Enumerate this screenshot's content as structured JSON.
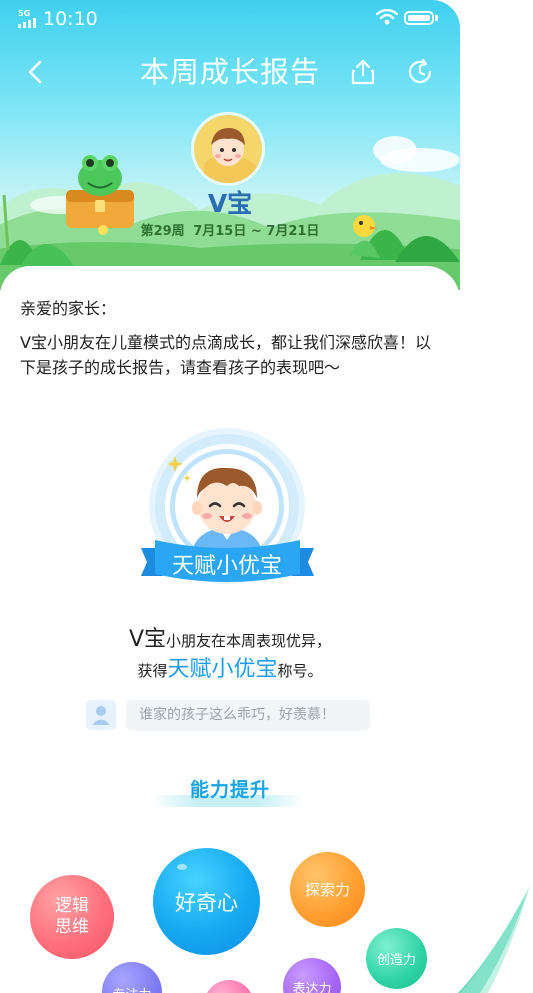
{
  "status_bar": {
    "network": "5G",
    "time": "10:10"
  },
  "nav": {
    "title": "本周成长报告"
  },
  "profile": {
    "name": "V宝",
    "week_label": "第29周",
    "date_range": "7月15日 ~ 7月21日"
  },
  "letter": {
    "greeting": "亲爱的家长：",
    "body": "V宝小朋友在儿童模式的点滴成长，都让我们深感欣喜！以下是孩子的成长报告，请查看孩子的表现吧～"
  },
  "award": {
    "badge_text": "天赋小优宝",
    "line1_name": "V宝",
    "line1_rest": "小朋友在本周表现优异，",
    "line2_prefix": "获得",
    "line2_title": "天赋小优宝",
    "line2_suffix": "称号。"
  },
  "comment": {
    "placeholder": "谁家的孩子这么乖巧，好羡慕！"
  },
  "ability": {
    "heading": "能力提升",
    "bubbles": [
      {
        "label": "逻辑\n思维",
        "color": "#f25665"
      },
      {
        "label": "好奇心",
        "color": "#0d8fe4"
      },
      {
        "label": "探索力",
        "color": "#f7871c"
      },
      {
        "label": "创造力",
        "color": "#1ebf92"
      },
      {
        "label": "专注力",
        "color": "#6b67e6"
      },
      {
        "label": "",
        "color": "#f45c9d"
      },
      {
        "label": "表达力",
        "color": "#9553ea"
      }
    ]
  },
  "colors": {
    "header_top": "#3fd0ee",
    "accent_blue": "#1d9df0",
    "ability_heading": "#16a4e4"
  }
}
